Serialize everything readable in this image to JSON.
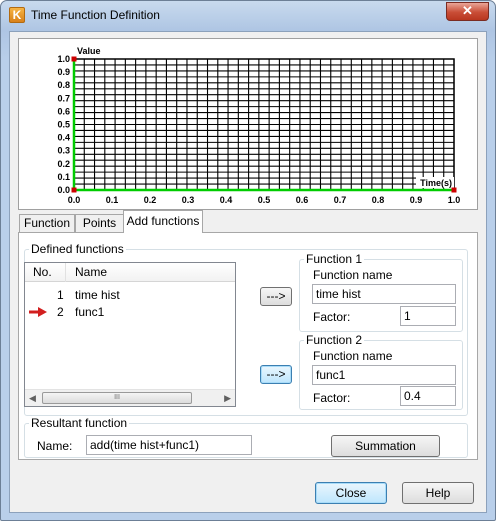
{
  "window": {
    "title": "Time Function Definition",
    "close_glyph": "✕",
    "app_icon_letter": "K"
  },
  "chart_data": {
    "type": "line",
    "ylabel": "Value",
    "xlabel": "Time(s)",
    "xlim": [
      0,
      1
    ],
    "ylim": [
      0,
      1
    ],
    "x_ticks": [
      "0.0",
      "0.1",
      "0.2",
      "0.3",
      "0.4",
      "0.5",
      "0.6",
      "0.7",
      "0.8",
      "0.9",
      "1.0"
    ],
    "y_ticks": [
      "0.0",
      "0.1",
      "0.2",
      "0.3",
      "0.4",
      "0.5",
      "0.6",
      "0.7",
      "0.8",
      "0.9",
      "1.0"
    ],
    "grid": true,
    "series": [
      {
        "x": [
          0,
          0,
          1
        ],
        "y": [
          1,
          0,
          0
        ],
        "color": "#00cc00"
      }
    ],
    "points": [
      {
        "x": 0,
        "y": 1
      },
      {
        "x": 0,
        "y": 0
      },
      {
        "x": 1,
        "y": 0
      }
    ],
    "point_color": "#cc0000"
  },
  "tabs": [
    {
      "label": "Function",
      "active": false
    },
    {
      "label": "Points",
      "active": false
    },
    {
      "label": "Add functions",
      "active": true
    }
  ],
  "defined": {
    "legend": "Defined functions",
    "columns": [
      "No.",
      "Name"
    ],
    "rows": [
      {
        "no": "1",
        "name": "time hist",
        "selected": false
      },
      {
        "no": "2",
        "name": "func1",
        "selected": true
      }
    ],
    "scroll_left": "◀",
    "scroll_right": "▶",
    "scroll_grip": "III",
    "arrow_color": "#d21f1f"
  },
  "function1": {
    "legend": "Function 1",
    "name_label": "Function name",
    "name_value": "time hist",
    "factor_label": "Factor:",
    "factor_value": "1",
    "assign_button": "--->"
  },
  "function2": {
    "legend": "Function 2",
    "name_label": "Function name",
    "name_value": "func1",
    "factor_label": "Factor:",
    "factor_value": "0.4",
    "assign_button": "--->"
  },
  "resultant": {
    "legend": "Resultant function",
    "name_label": "Name:",
    "name_value": "add(time hist+func1)",
    "summation_button": "Summation"
  },
  "footer": {
    "close_button": "Close",
    "help_button": "Help"
  }
}
